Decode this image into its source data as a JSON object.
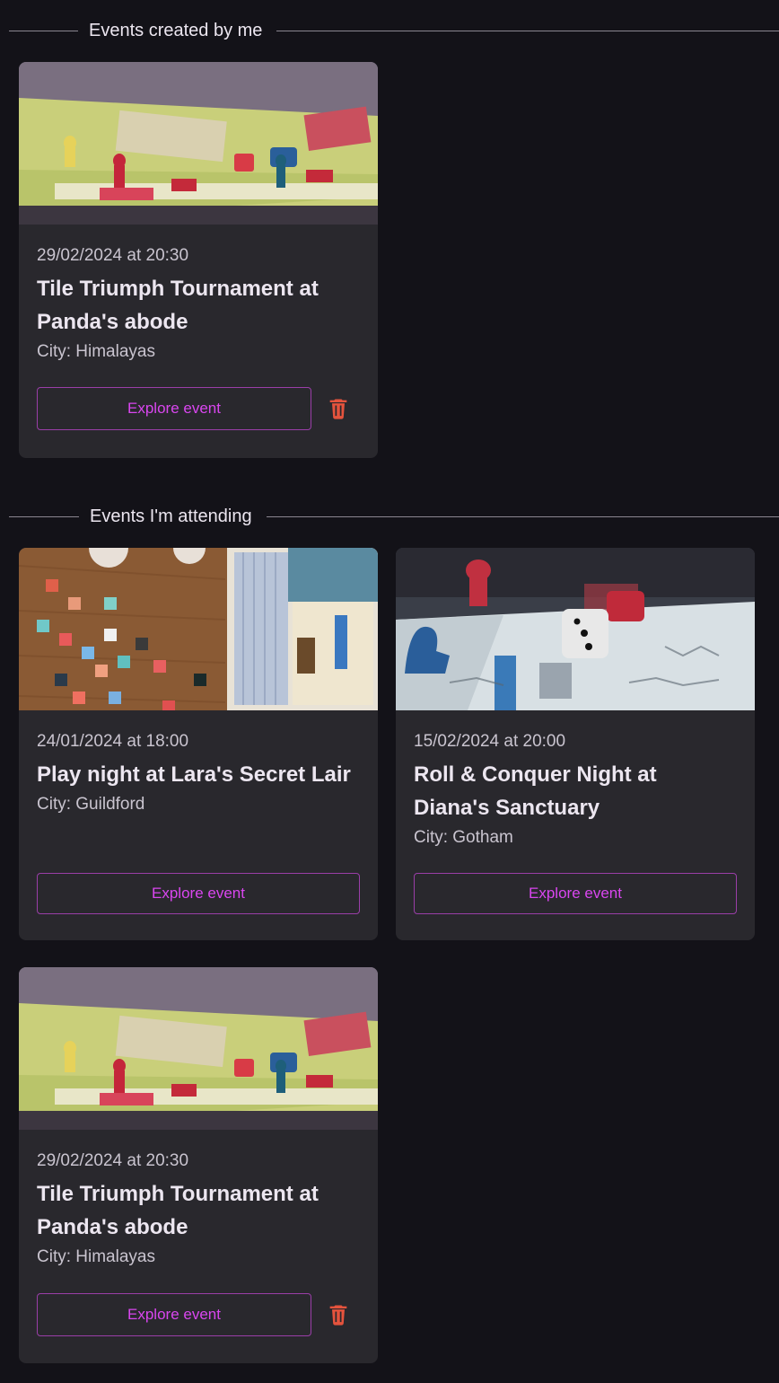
{
  "sections": {
    "created": {
      "title": "Events created by me"
    },
    "attending": {
      "title": "Events I'm attending"
    }
  },
  "created_events": [
    {
      "date": "29/02/2024 at 20:30",
      "title": "Tile Triumph Tournament at Panda's abode",
      "city": "City: Himalayas",
      "button": "Explore event",
      "image": "board-game-tokens-photo"
    }
  ],
  "attending_events": [
    {
      "date": "24/01/2024 at 18:00",
      "title": "Play night at Lara's Secret Lair",
      "city": "City: Guildford",
      "button": "Explore event",
      "image": "azul-tiles-photo"
    },
    {
      "date": "15/02/2024 at 20:00",
      "title": "Roll & Conquer Night at Diana's Sanctuary",
      "city": "City: Gotham",
      "button": "Explore event",
      "image": "dice-meeples-photo"
    },
    {
      "date": "29/02/2024 at 20:30",
      "title": "Tile Triumph Tournament at Panda's abode",
      "city": "City: Himalayas",
      "button": "Explore event",
      "image": "board-game-tokens-photo"
    }
  ],
  "colors": {
    "accent": "#d946ef",
    "danger": "#e5533d",
    "card": "#29282d",
    "background": "#131218"
  }
}
